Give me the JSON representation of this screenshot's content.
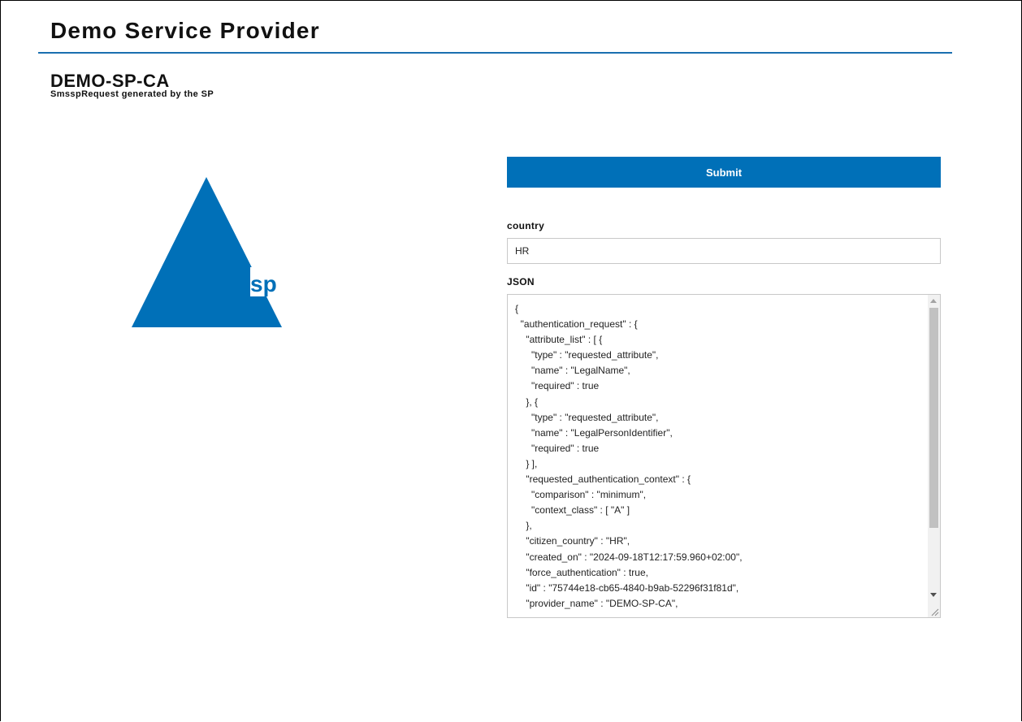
{
  "header": {
    "site_title": "Demo Service Provider"
  },
  "provider": {
    "name": "DEMO-SP-CA",
    "subtitle": "SmsspRequest generated by the SP"
  },
  "logo": {
    "text": "sp",
    "color": "#0070b8"
  },
  "form": {
    "submit_label": "Submit",
    "country_label": "country",
    "country_value": "HR",
    "json_label": "JSON",
    "json_value": "{\n  \"authentication_request\" : {\n    \"attribute_list\" : [ {\n      \"type\" : \"requested_attribute\",\n      \"name\" : \"LegalName\",\n      \"required\" : true\n    }, {\n      \"type\" : \"requested_attribute\",\n      \"name\" : \"LegalPersonIdentifier\",\n      \"required\" : true\n    } ],\n    \"requested_authentication_context\" : {\n      \"comparison\" : \"minimum\",\n      \"context_class\" : [ \"A\" ]\n    },\n    \"citizen_country\" : \"HR\",\n    \"created_on\" : \"2024-09-18T12:17:59.960+02:00\",\n    \"force_authentication\" : true,\n    \"id\" : \"75744e18-cb65-4840-b9ab-52296f31f81d\",\n    \"provider_name\" : \"DEMO-SP-CA\","
  },
  "colors": {
    "accent": "#0070b8",
    "rule": "#1a6fb0"
  }
}
